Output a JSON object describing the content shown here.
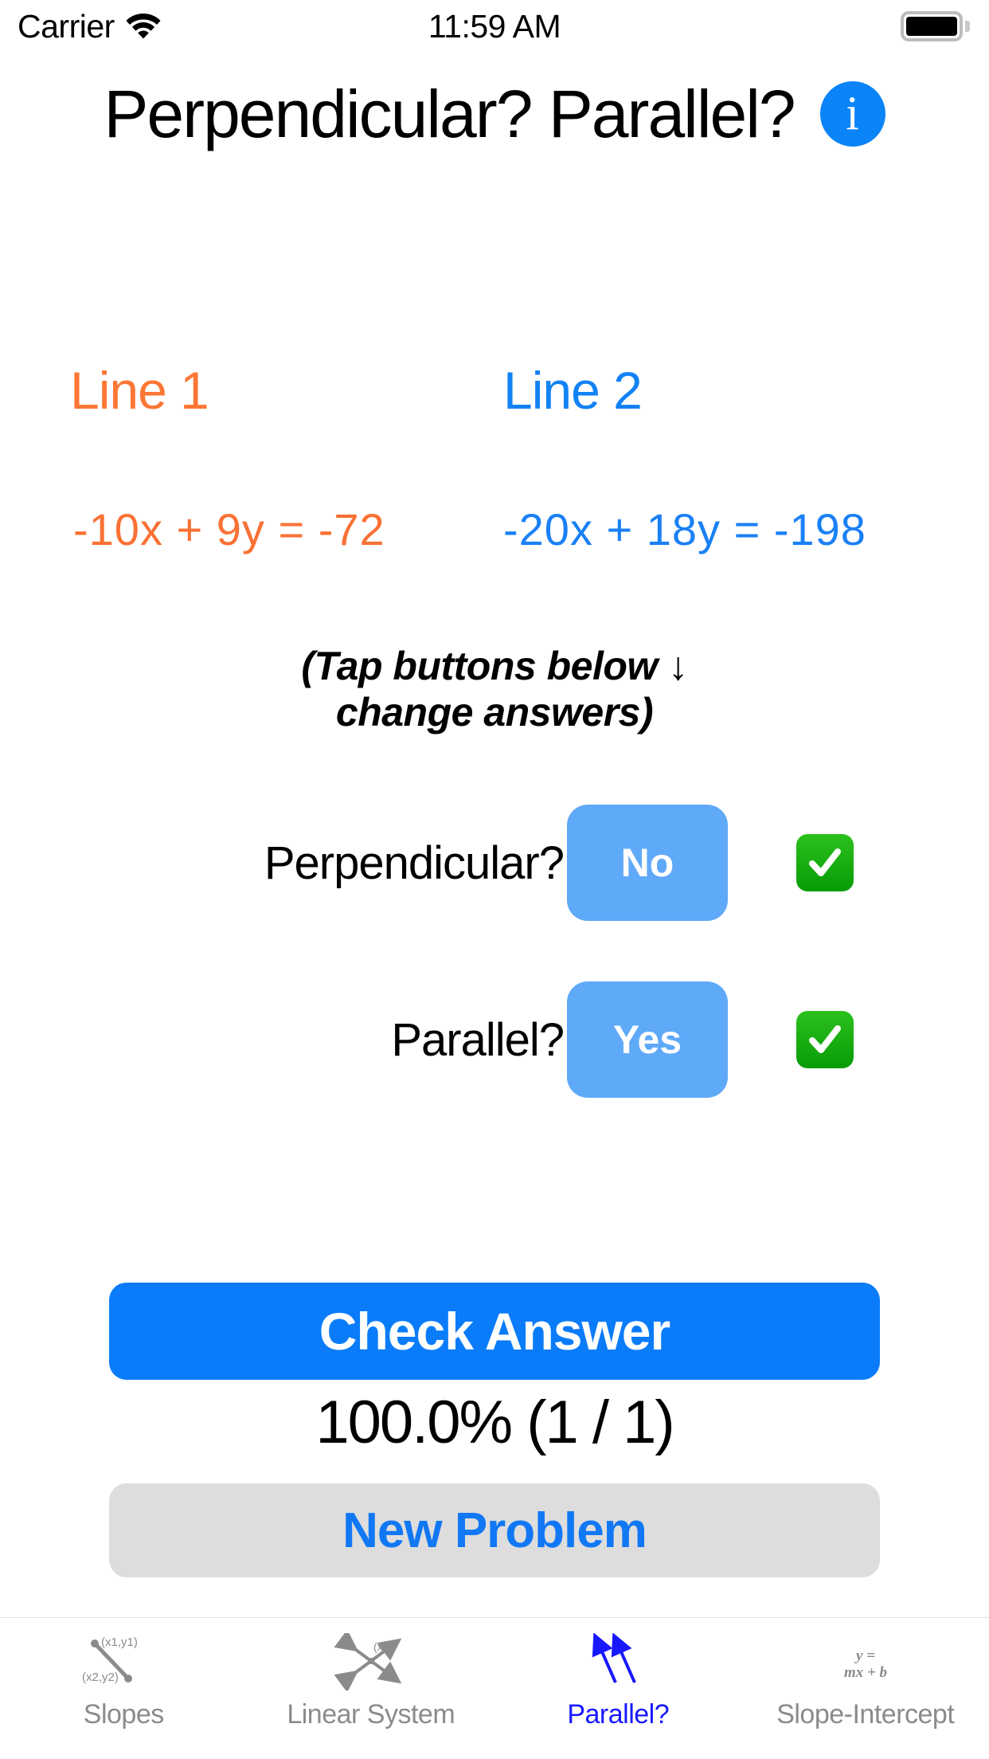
{
  "status_bar": {
    "carrier": "Carrier",
    "wifi_icon": "wifi-icon",
    "time": "11:59 AM",
    "battery_icon": "battery-full-icon"
  },
  "header": {
    "title": "Perpendicular? Parallel?",
    "info_button_label": "i",
    "info_icon": "info-circle-icon",
    "accent_color": "#0a84f7"
  },
  "problem": {
    "line1": {
      "heading": "Line 1",
      "equation": "-10x  +  9y  =  -72",
      "color": "#f97134"
    },
    "line2": {
      "heading": "Line 2",
      "equation": "-20x  +  18y  =  -198",
      "color": "#1a80f5"
    },
    "tap_hint_line1": "(Tap buttons below ↓",
    "tap_hint_line2": "change answers)"
  },
  "answers": [
    {
      "label": "Perpendicular?",
      "value": "No",
      "result_icon": "green-check-icon",
      "correct": true
    },
    {
      "label": "Parallel?",
      "value": "Yes",
      "result_icon": "green-check-icon",
      "correct": true
    }
  ],
  "actions": {
    "check_answer": "Check Answer",
    "score": "100.0% (1 / 1)",
    "new_problem": "New Problem",
    "check_button_color": "#0a7cf9",
    "new_problem_button_color": "#dddddd",
    "new_problem_text_color": "#1178f5"
  },
  "tabbar": {
    "active_color": "#1818ff",
    "inactive_color": "#8b8b8b",
    "items": [
      {
        "label": "Slopes",
        "icon": "slope-two-points-icon",
        "active": false,
        "icon_text_1": "(x1,y1)",
        "icon_text_2": "(x2,y2)"
      },
      {
        "label": "Linear System",
        "icon": "crossing-lines-icon",
        "active": false,
        "icon_text_1": "(x,y)"
      },
      {
        "label": "Parallel?",
        "icon": "parallel-arrows-icon",
        "active": true
      },
      {
        "label": "Slope-Intercept",
        "icon": "slope-intercept-formula-icon",
        "active": false,
        "icon_text_1": "y =",
        "icon_text_2": "mx + b"
      }
    ]
  }
}
